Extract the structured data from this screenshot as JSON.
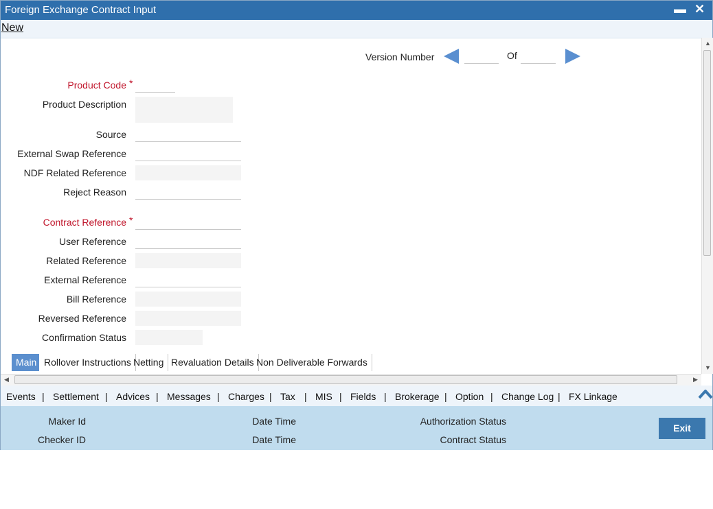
{
  "window": {
    "title": "Foreign Exchange Contract Input",
    "minimize": "▬",
    "close": "✕"
  },
  "menu": {
    "new": "New"
  },
  "version": {
    "label": "Version Number",
    "of": "Of",
    "current": "",
    "total": ""
  },
  "fields": {
    "product_code": {
      "label": "Product Code",
      "value": "",
      "required": "*"
    },
    "product_description": {
      "label": "Product Description",
      "value": ""
    },
    "source": {
      "label": "Source",
      "value": ""
    },
    "external_swap_reference": {
      "label": "External Swap Reference",
      "value": ""
    },
    "ndf_related_reference": {
      "label": "NDF Related Reference",
      "value": ""
    },
    "reject_reason": {
      "label": "Reject Reason",
      "value": ""
    },
    "contract_reference": {
      "label": "Contract Reference",
      "value": "",
      "required": "*"
    },
    "user_reference": {
      "label": "User Reference",
      "value": ""
    },
    "related_reference": {
      "label": "Related Reference",
      "value": ""
    },
    "external_reference": {
      "label": "External Reference",
      "value": ""
    },
    "bill_reference": {
      "label": "Bill Reference",
      "value": ""
    },
    "reversed_reference": {
      "label": "Reversed Reference",
      "value": ""
    },
    "confirmation_status": {
      "label": "Confirmation Status",
      "value": ""
    }
  },
  "tabs": [
    "Main",
    "Rollover Instructions",
    "Netting",
    "Revaluation Details",
    "Non Deliverable Forwards"
  ],
  "links": [
    "Events",
    "Settlement",
    "Advices",
    "Messages",
    "Charges",
    "Tax",
    "MIS",
    "Fields",
    "Brokerage",
    "Option",
    "Change Log",
    "FX Linkage"
  ],
  "footer": {
    "maker_id": "Maker Id",
    "checker_id": "Checker ID",
    "date_time_1": "Date Time",
    "date_time_2": "Date Time",
    "authorization_status": "Authorization Status",
    "contract_status": "Contract Status",
    "exit": "Exit"
  },
  "colors": {
    "titlebar": "#2f6fac",
    "accent": "#5b8fce",
    "required": "#c0142a",
    "footer": "#c0dcee",
    "exit_button": "#3b78ae"
  }
}
